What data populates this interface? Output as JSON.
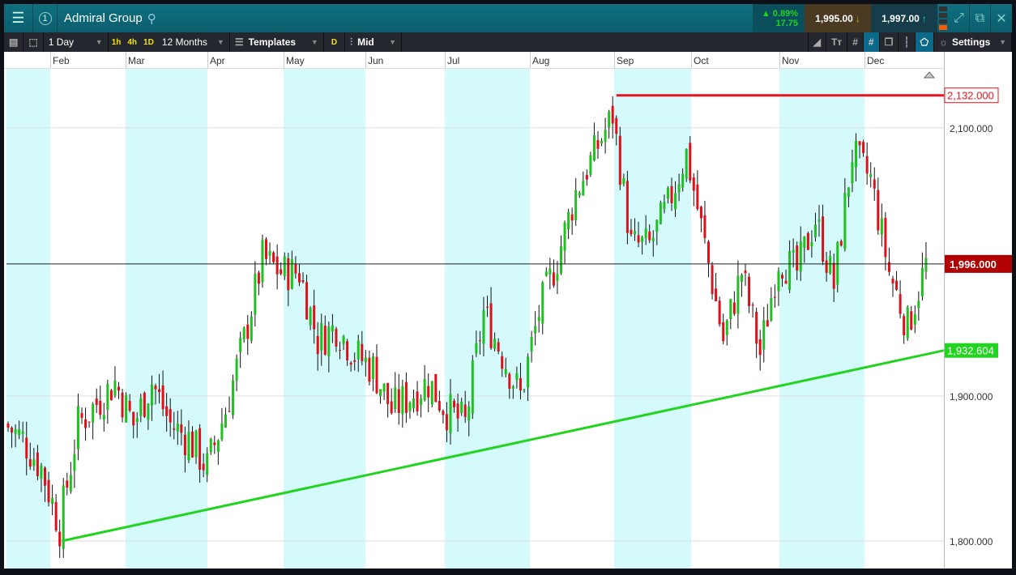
{
  "header": {
    "title": "Admiral Group",
    "change_pct": "▲ 0.89%",
    "change_abs": "17.75",
    "sell": "1,995.00",
    "buy": "1,997.00",
    "badge": "1"
  },
  "toolbar": {
    "interval": "1 Day",
    "q1": "1h",
    "q2": "4h",
    "q3": "1D",
    "range": "12 Months",
    "templates": "Templates",
    "d": "D",
    "price_type": "Mid",
    "settings": "Settings"
  },
  "colors": {
    "up": "#1fc01f",
    "down": "#e0101a",
    "trend": "#22d320",
    "resistance": "#e8141e",
    "shade": "#d4fafc"
  },
  "chart_data": {
    "type": "candlestick",
    "title": "Admiral Group",
    "x_months": [
      "Feb",
      "Mar",
      "Apr",
      "May",
      "Jun",
      "Jul",
      "Aug",
      "Sep",
      "Oct",
      "Nov",
      "Dec"
    ],
    "y_ticks": [
      "1,800.000",
      "1,900.000",
      "2,100.000"
    ],
    "y_tick_values": [
      1800,
      1900,
      2100
    ],
    "y_scale": "log",
    "weekly_closes": [
      1880,
      1870,
      1850,
      1810,
      1880,
      1895,
      1910,
      1880,
      1910,
      1880,
      1870,
      1850,
      1890,
      1940,
      2000,
      1990,
      1990,
      1940,
      1950,
      1930,
      1920,
      1890,
      1900,
      1910,
      1890,
      1880,
      1960,
      1930,
      1900,
      1960,
      2000,
      2050,
      2080,
      2110,
      2010,
      2010,
      2040,
      2080,
      2010,
      1940,
      1990,
      1930,
      2000,
      1990,
      2030,
      1980,
      2080,
      2060,
      1990,
      1950,
      1996
    ],
    "current_price": 1996,
    "current_label": "1,996.000",
    "resistance": {
      "price": 2132,
      "label": "2,132.000",
      "from_week": 33
    },
    "support": {
      "from_week": 3,
      "from_price": 1800,
      "to_price": 1932.604,
      "label": "1,932.604"
    }
  }
}
